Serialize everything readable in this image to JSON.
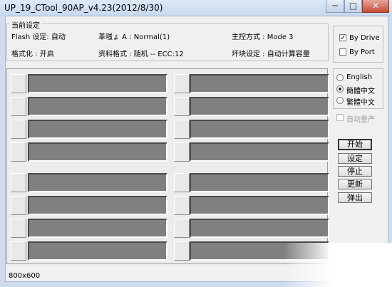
{
  "window": {
    "title": "UP_19_CTool_90AP_v4.23(2012/8/30)",
    "minimize_glyph": "─",
    "maximize_glyph": "□",
    "close_glyph": "✕"
  },
  "current_settings": {
    "legend": "当前设定",
    "flash_setting": "Flash 设定: 自动",
    "format": "格式化 : 开启",
    "chip": "革嗤ょ A : Normal(1)",
    "data_format": "资料格式 : 随机 -- ECC:12",
    "controller_mode": "主控方式 : Mode 3",
    "bad_block": "坏块设定 : 自动计算容量"
  },
  "detect_mode": {
    "by_drive": {
      "label": "By Drive",
      "checked": true,
      "check_glyph": "✓"
    },
    "by_port": {
      "label": "By Port",
      "checked": false
    }
  },
  "language": {
    "options": [
      {
        "label": "English",
        "selected": false
      },
      {
        "label": "簡體中文",
        "selected": true
      },
      {
        "label": "繁體中文",
        "selected": false
      }
    ]
  },
  "auto_mass_production": {
    "label": "自动量产",
    "checked": false,
    "enabled": false
  },
  "actions": {
    "start": "开始",
    "settings": "设定",
    "stop": "停止",
    "refresh": "更新",
    "eject": "弹出"
  },
  "status": {
    "resolution": "800x600"
  },
  "ports": {
    "count": 16
  }
}
